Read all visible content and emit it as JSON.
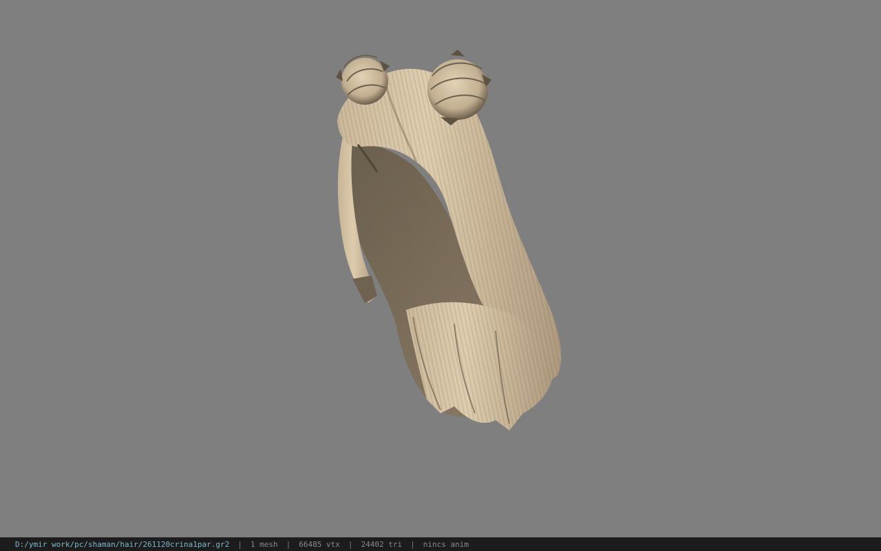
{
  "viewport": {
    "background": "#7f7f7f",
    "model_name": "hair mesh"
  },
  "status_bar": {
    "file_path": "D:/ymir work/pc/shaman/hair/261120crina1par.gr2",
    "separator": "|",
    "mesh_count": "1 mesh",
    "vertex_count": "66485 vtx",
    "triangle_count": "24402 tri",
    "anim_status": "nincs anim"
  },
  "colors": {
    "hair_light": "#d8c6a8",
    "hair_mid": "#b7a386",
    "hair_dark": "#5e5343",
    "status_path": "#7fb8cf",
    "status_text": "#8a8a8a"
  }
}
